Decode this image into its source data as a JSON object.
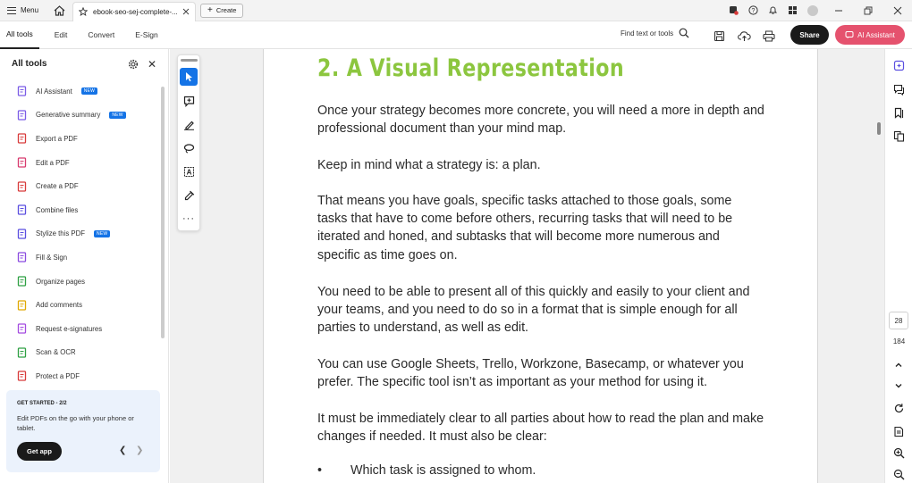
{
  "titlebar": {
    "menu_label": "Menu",
    "tab_title": "ebook-seo-sej-complete-...",
    "create_label": "Create",
    "icons": [
      "home-icon",
      "star-icon",
      "close-icon",
      "plus-icon",
      "no-sync-icon",
      "help-icon",
      "bell-icon",
      "apps-grid-icon",
      "avatar",
      "minimize-icon",
      "restore-icon",
      "close-window-icon"
    ]
  },
  "toolbar": {
    "tabs": [
      "All tools",
      "Edit",
      "Convert",
      "E-Sign"
    ],
    "active_tab": "All tools",
    "find_label": "Find text or tools",
    "share_label": "Share",
    "ai_assistant_label": "AI Assistant"
  },
  "left_panel": {
    "title": "All tools",
    "badge_text": "NEW",
    "tools": [
      {
        "label": "AI Assistant",
        "badge": true,
        "icon": "ai-assistant-icon",
        "color": "#7b5ce6"
      },
      {
        "label": "Generative summary",
        "badge": true,
        "icon": "generative-summary-icon",
        "color": "#7b5ce6"
      },
      {
        "label": "Export a PDF",
        "badge": false,
        "icon": "export-pdf-icon",
        "color": "#d83a3a"
      },
      {
        "label": "Edit a PDF",
        "badge": false,
        "icon": "edit-pdf-icon",
        "color": "#d83a6e"
      },
      {
        "label": "Create a PDF",
        "badge": false,
        "icon": "create-pdf-icon",
        "color": "#d83a3a"
      },
      {
        "label": "Combine files",
        "badge": false,
        "icon": "combine-files-icon",
        "color": "#5b4fe0"
      },
      {
        "label": "Stylize this PDF",
        "badge": true,
        "icon": "stylize-pdf-icon",
        "color": "#5b4fe0"
      },
      {
        "label": "Fill & Sign",
        "badge": false,
        "icon": "fill-sign-icon",
        "color": "#8a4be0"
      },
      {
        "label": "Organize pages",
        "badge": false,
        "icon": "organize-pages-icon",
        "color": "#2ea043"
      },
      {
        "label": "Add comments",
        "badge": false,
        "icon": "add-comments-icon",
        "color": "#e0a800"
      },
      {
        "label": "Request e-signatures",
        "badge": false,
        "icon": "request-esignature-icon",
        "color": "#a34be0"
      },
      {
        "label": "Scan & OCR",
        "badge": false,
        "icon": "scan-ocr-icon",
        "color": "#2ea043"
      },
      {
        "label": "Protect a PDF",
        "badge": false,
        "icon": "protect-pdf-icon",
        "color": "#d83a3a"
      }
    ],
    "promo": {
      "title": "GET STARTED - 2/2",
      "text": "Edit PDFs on the go with your phone or tablet.",
      "button": "Get app"
    }
  },
  "floating_tools": [
    "select-cursor-icon",
    "add-comment-icon",
    "highlight-pen-icon",
    "draw-lasso-icon",
    "text-box-icon",
    "fill-sign-pen-icon",
    "more-icon"
  ],
  "document": {
    "heading": "2. A Visual Representation",
    "paragraphs": [
      "Once your strategy becomes more concrete, you will need a more in depth and professional document than your mind map.",
      "Keep in mind what a strategy is: a plan.",
      "That means you have goals, specific tasks attached to those goals, some tasks that have to come before others, recurring tasks that will need to be iterated and honed, and subtasks that will become more numerous and specific as time goes on.",
      "You need to be able to present all of this quickly and easily to your client and your teams, and you need to do so in a format that is simple enough for all parties to understand, as well as edit.",
      "You can use Google Sheets, Trello, Workzone, Basecamp, or whatever you prefer. The specific tool isn’t as important as your method for using it.",
      "It must be immediately clear to all parties about how to read the plan and make changes if needed. It must also be clear:"
    ],
    "bullet_symbol": "•",
    "bullet": "Which task is assigned to whom."
  },
  "right_rail": {
    "current_page": "28",
    "total_pages": "184",
    "icons": [
      "ai-chat-icon",
      "comments-icon",
      "bookmarks-icon",
      "copy-pages-icon",
      "page-up-icon",
      "page-down-icon",
      "refresh-icon",
      "page-settings-icon",
      "zoom-in-icon",
      "zoom-out-icon"
    ]
  }
}
